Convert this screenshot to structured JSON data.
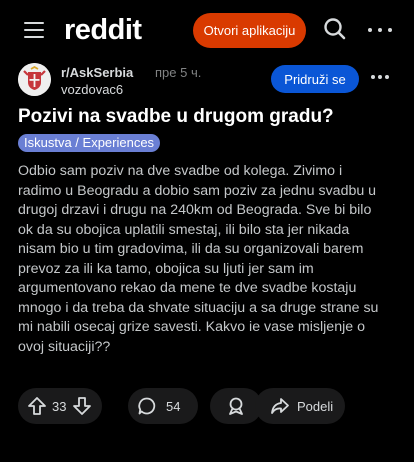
{
  "header": {
    "logo": "reddit",
    "open_app_label": "Otvori aplikaciju"
  },
  "post": {
    "subreddit": "r/AskSerbia",
    "age": "пре 5 ч.",
    "author": "vozdovac6",
    "join_label": "Pridruži se",
    "title": "Pozivi na svadbe u drugom gradu?",
    "flair": "Iskustva / Experiences",
    "body_lines": [
      "Odbio sam poziv na dve svadbe od kolega. Zivimo i",
      "radimo u Beogradu a dobio sam poziv za jednu svadbu u",
      "drugoj drzavi i drugu na 240km od Beograda. Sve bi bilo",
      "ok da su obojica uplatili smestaj, ili bilo sta jer nikada",
      "nisam bio u tim gradovima, ili da su organizovali barem",
      "prevoz za ili ka tamo, obojica su ljuti jer sam im",
      "argumentovano rekao da mene te dve svadbe kostaju",
      "mnogo i da treba da shvate situaciju a sa druge strane su",
      "mi nabili osecaj grize savesti. Kakvo ie vase misljenje o",
      "ovoj situaciji??"
    ]
  },
  "actions": {
    "vote_count": "33",
    "comment_count": "54",
    "share_label": "Podeli"
  },
  "colors": {
    "background": "#000000",
    "open_app_button": "#d93a00",
    "join_button": "#0a56d6",
    "flair": "#6a7fd4",
    "action_pill": "#1a1a1b"
  },
  "icons": [
    "hamburger-menu-icon",
    "search-icon",
    "more-options-icon",
    "upvote-icon",
    "downvote-icon",
    "comment-icon",
    "award-icon",
    "share-icon"
  ]
}
